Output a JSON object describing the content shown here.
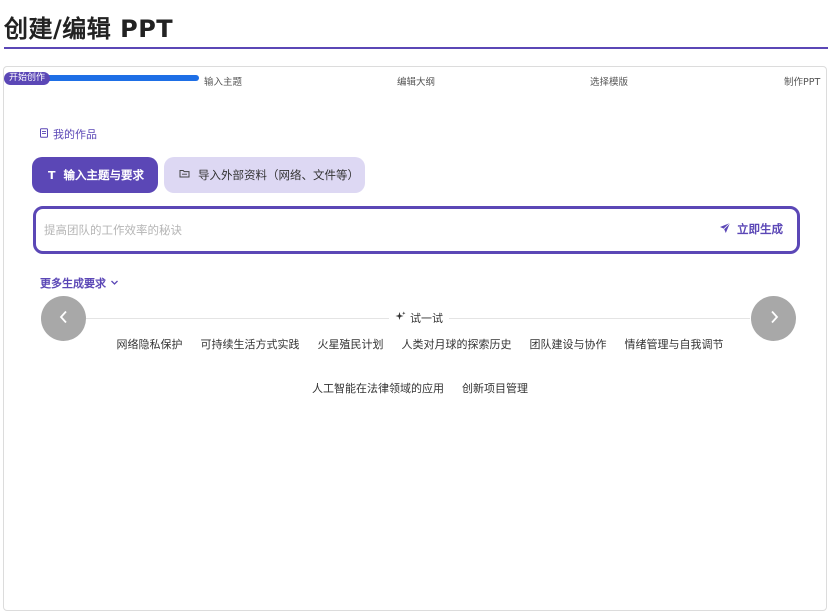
{
  "page": {
    "title": "创建/编辑 PPT"
  },
  "progress": {
    "badge": "开始创作",
    "fraction": 0.25,
    "steps": [
      "输入主题",
      "编辑大纲",
      "选择模版",
      "制作PPT"
    ]
  },
  "my_works": {
    "label": "我的作品"
  },
  "tabs": [
    {
      "icon": "text-icon",
      "icon_glyph": "T",
      "label": "输入主题与要求",
      "active": true
    },
    {
      "icon": "folder-icon",
      "label": "导入外部资料（网络、文件等）",
      "active": false
    }
  ],
  "input": {
    "value": "",
    "placeholder": "提高团队的工作效率的秘诀"
  },
  "generate_button": {
    "label": "立即生成",
    "icon": "send-icon"
  },
  "more": {
    "label": "更多生成要求",
    "icon": "chevron-down-icon"
  },
  "try": {
    "label": "试一试",
    "icon": "sparkle-icon"
  },
  "suggestions": {
    "row1": [
      "网络隐私保护",
      "可持续生活方式实践",
      "火星殖民计划",
      "人类对月球的探索历史",
      "团队建设与协作",
      "情绪管理与自我调节"
    ],
    "row2": [
      "人工智能在法律领域的应用",
      "创新项目管理"
    ]
  },
  "colors": {
    "accent": "#5b47b6",
    "accent_light": "#ddd8f3",
    "progress": "#1e6fe6",
    "nav": "#a8a8a8"
  }
}
